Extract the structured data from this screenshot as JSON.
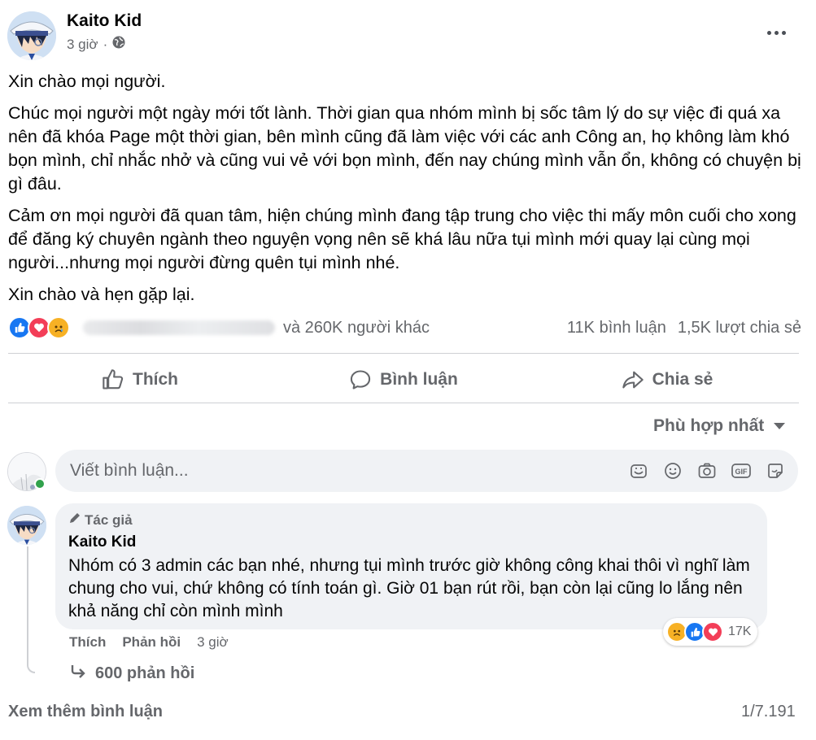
{
  "post": {
    "author": "Kaito Kid",
    "time": "3 giờ",
    "separator": "·",
    "paragraphs": [
      "Xin chào mọi người.",
      "Chúc mọi người một ngày mới tốt lành. Thời gian qua nhóm mình bị sốc tâm lý do sự việc đi quá xa nên đã khóa Page một thời gian, bên mình cũng đã làm việc với các anh Công an, họ không làm khó bọn mình, chỉ nhắc nhở và cũng vui vẻ với bọn mình, đến nay chúng mình vẫn ổn, không có chuyện bị gì đâu.",
      "Cảm ơn mọi người đã quan tâm, hiện chúng mình đang tập trung cho việc thi mấy môn cuối cho xong để đăng ký chuyên ngành theo nguyện vọng nên sẽ khá lâu nữa tụi mình mới quay lại cùng mọi người...nhưng mọi người đừng quên tụi mình nhé.",
      "Xin chào và hẹn gặp lại."
    ]
  },
  "reactions": {
    "icons": [
      "like-icon",
      "love-icon",
      "sad-icon"
    ],
    "others_text": "và 260K người khác",
    "comments_count": "11K bình luận",
    "shares_count": "1,5K lượt chia sẻ"
  },
  "actions": {
    "like": "Thích",
    "comment": "Bình luận",
    "share": "Chia sẻ"
  },
  "sort": {
    "label": "Phù hợp nhất"
  },
  "composer": {
    "placeholder": "Viết bình luận...",
    "icons": [
      "sticker-face-icon",
      "emoji-icon",
      "camera-icon",
      "gif-icon",
      "sticker-icon"
    ]
  },
  "comment": {
    "badge": "Tác giả",
    "author": "Kaito Kid",
    "text": "Nhóm có 3 admin các bạn nhé, nhưng tụi mình trước giờ không công khai thôi vì nghĩ làm chung cho vui, chứ không có tính toán gì. Giờ 01 bạn rút rồi, bạn còn lại cũng lo lắng nên khả năng chỉ còn mình mình",
    "reaction_count": "17K",
    "like_label": "Thích",
    "reply_label": "Phản hồi",
    "time": "3 giờ",
    "replies_label": "600 phản hồi"
  },
  "footer": {
    "see_more": "Xem thêm bình luận",
    "pager": "1/7.191"
  },
  "colors": {
    "like_blue": "#1877f2",
    "love_red": "#f33e58",
    "sad_yellow": "#f7b125",
    "secondary_text": "#65676b",
    "online_green": "#31a24c"
  }
}
